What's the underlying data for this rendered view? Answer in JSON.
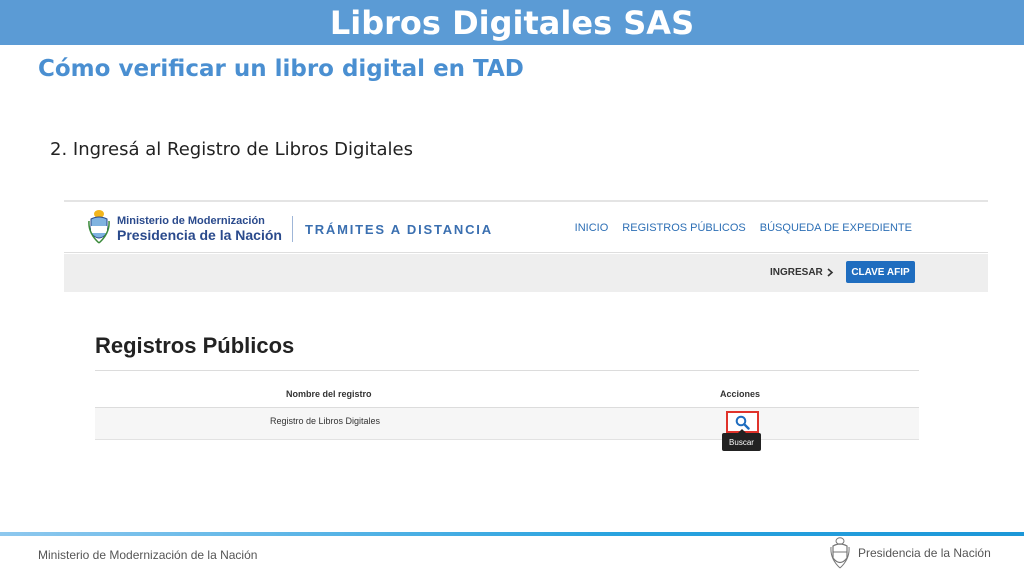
{
  "slide": {
    "title": "Libros Digitales SAS",
    "subtitle": "Cómo verificar un libro digital en TAD",
    "step": "2. Ingresá al Registro de Libros Digitales"
  },
  "tad": {
    "ministry_line1": "Ministerio de Modernización",
    "ministry_line2": "Presidencia de la Nación",
    "brand": "TRÁMITES A DISTANCIA",
    "nav": [
      "INICIO",
      "REGISTROS PÚBLICOS",
      "BÚSQUEDA DE EXPEDIENTE"
    ],
    "login_label": "INGRESAR",
    "login_button": "CLAVE AFIP",
    "page_title": "Registros Públicos",
    "table": {
      "headers": [
        "Nombre del registro",
        "Acciones"
      ],
      "rows": [
        {
          "name": "Registro de Libros Digitales"
        }
      ]
    },
    "tooltip": "Buscar"
  },
  "footer": {
    "left": "Ministerio de Modernización de la Nación",
    "right": "Presidencia de la Nación"
  },
  "colors": {
    "title_bar": "#5b9bd5",
    "subtitle": "#4a8fd1",
    "tad_blue": "#1f6dbf",
    "highlight": "#e0332b"
  },
  "icons": {
    "crest": "coat-of-arms-icon",
    "search": "search-icon",
    "chevron": "chevron-right-icon"
  }
}
